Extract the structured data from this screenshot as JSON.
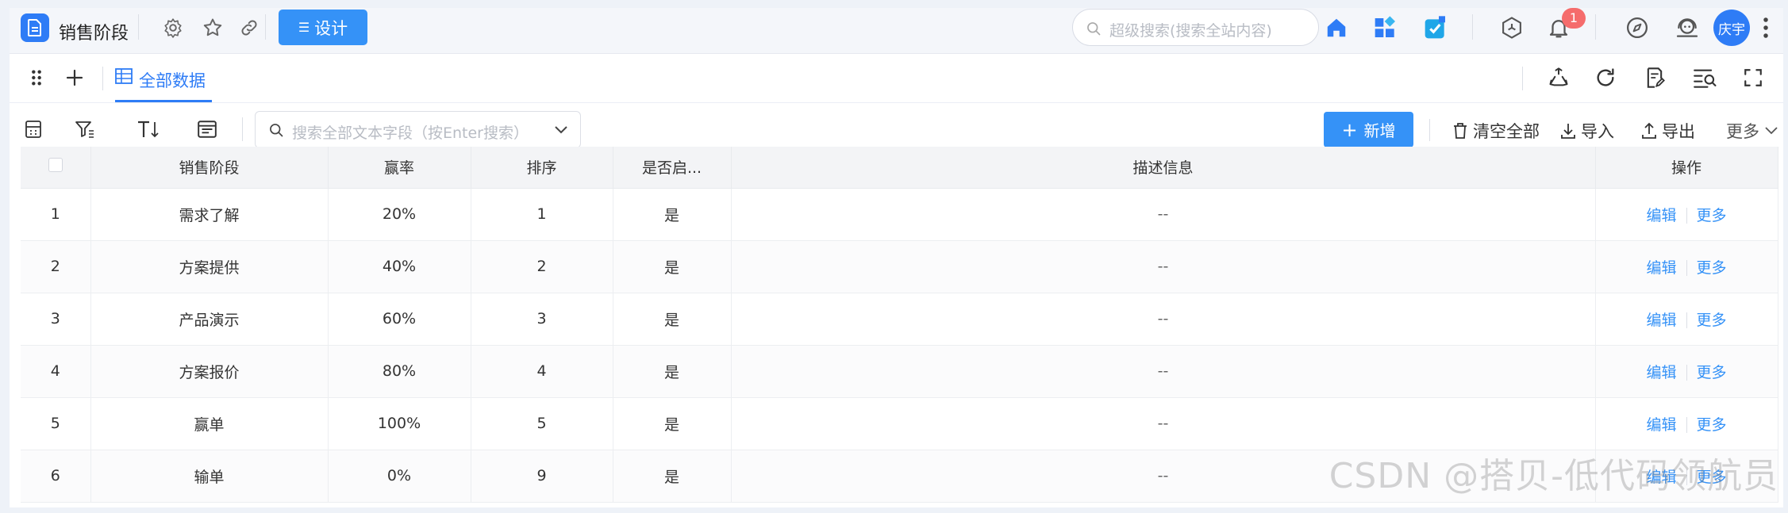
{
  "app": {
    "title": "销售阶段",
    "design_label": "设计"
  },
  "search": {
    "placeholder": "超级搜索(搜索全站内容)"
  },
  "notifications": {
    "count": "1"
  },
  "user": {
    "avatar_text": "庆宇"
  },
  "view": {
    "tab_label": "全部数据"
  },
  "toolbar": {
    "filter_placeholder": "搜索全部文本字段（按Enter搜索）",
    "add_label": "新增",
    "clear_label": "清空全部",
    "import_label": "导入",
    "export_label": "导出",
    "more_label": "更多"
  },
  "table": {
    "columns": [
      "销售阶段",
      "赢率",
      "排序",
      "是否启...",
      "描述信息",
      "操作"
    ],
    "rows": [
      {
        "index": "1",
        "stage": "需求了解",
        "rate": "20%",
        "sort": "1",
        "enabled": "是",
        "desc": "--",
        "edit": "编辑",
        "more": "更多"
      },
      {
        "index": "2",
        "stage": "方案提供",
        "rate": "40%",
        "sort": "2",
        "enabled": "是",
        "desc": "--",
        "edit": "编辑",
        "more": "更多"
      },
      {
        "index": "3",
        "stage": "产品演示",
        "rate": "60%",
        "sort": "3",
        "enabled": "是",
        "desc": "--",
        "edit": "编辑",
        "more": "更多"
      },
      {
        "index": "4",
        "stage": "方案报价",
        "rate": "80%",
        "sort": "4",
        "enabled": "是",
        "desc": "--",
        "edit": "编辑",
        "more": "更多"
      },
      {
        "index": "5",
        "stage": "赢单",
        "rate": "100%",
        "sort": "5",
        "enabled": "是",
        "desc": "--",
        "edit": "编辑",
        "more": "更多"
      },
      {
        "index": "6",
        "stage": "输单",
        "rate": "0%",
        "sort": "9",
        "enabled": "是",
        "desc": "--",
        "edit": "编辑",
        "more": "更多"
      }
    ]
  },
  "watermark": "CSDN @搭贝-低代码领航员",
  "colors": {
    "accent": "#3592f7",
    "badge": "#f56c6c",
    "header_bg": "#f4f6fa"
  }
}
